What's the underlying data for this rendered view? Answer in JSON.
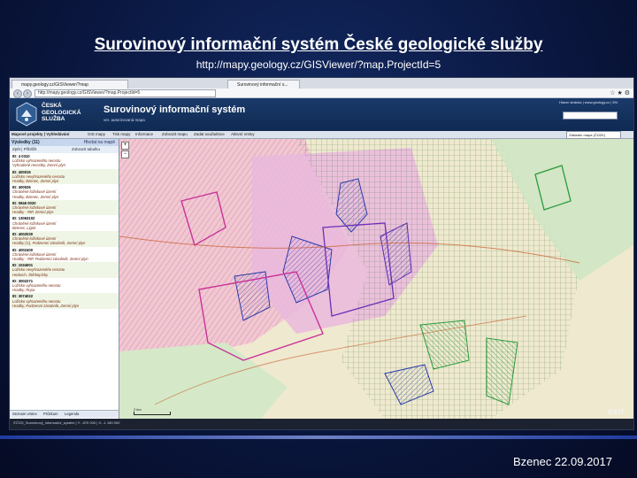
{
  "slide": {
    "title": "Surovinový informační systém České geologické služby",
    "url": "http://mapy.geology.cz/GISViewer/?map.ProjectId=5",
    "footer": "Bzenec 22.09.2017"
  },
  "browser": {
    "tab_1": "mapy.geology.cz/GISViewer/?map",
    "tab_2": "Surovinový informační s...",
    "address": "http://mapy.geology.cz/GISViewer/?map.ProjectId=5",
    "window_controls": "☆ ★ ⚙"
  },
  "app": {
    "logo_line1": "ČESKÁ",
    "logo_line2": "GEOLOGICKÁ",
    "logo_line3": "SLUŽBA",
    "title": "Surovinový informační systém",
    "subtitle": "ver. autorizovaná mapa",
    "header_links": "Hlavní stránka | www.geology.cz | EN",
    "toolbar": [
      "Mapové projekty | Vyhledávání",
      "GIS mapy",
      "Tisk mapy",
      "Informace",
      "Zobrazit mapu",
      "Zadat souřadnice",
      "Aktivní vrstvy"
    ],
    "basemap": "Základní mapa (ČÚZK)",
    "panel": {
      "heading": "Výsledky (11)",
      "heading_right": "Hledat na mapě",
      "tab_left": "Zpět | Přiblížit",
      "tab_right": "Zobrazit tabulku",
      "features": [
        {
          "id": "ID: 4 0310",
          "lines": [
            "Ložisko vyhrazeného nerostu",
            "Vyhradené nerostky, Zemní plyn"
          ]
        },
        {
          "id": "ID: 400015",
          "lines": [
            "Ložisko nevyhrazeného nerostu",
            "Hradky, Bzenec, Zemní plyn"
          ]
        },
        {
          "id": "ID: 400026",
          "lines": [
            "Chráněné ložiskové území",
            "Hradky, Bzenec, Zemní plyn"
          ]
        },
        {
          "id": "ID: 0846 0020",
          "lines": [
            "Chráněné ložiskové území",
            "Hradky - RIP, Zemní plyn"
          ]
        },
        {
          "id": "ID: 13063102",
          "lines": [
            "Chráněné ložiskové území",
            "Bzenec, Lignit"
          ]
        },
        {
          "id": "ID: 4002030",
          "lines": [
            "Chráněné ložiskové území",
            "Hradky (C), Podzemní zásobník, Zemní plyn"
          ]
        },
        {
          "id": "ID: 4002400",
          "lines": [
            "Chráněné ložiskové území",
            "Hradky - RIP, Podzemní zásobník, Zemní plyn"
          ]
        },
        {
          "id": "ID: 1034001",
          "lines": [
            "Ložisko nevyhrazeného nerostu",
            "Hodonín, Štěrkopísky"
          ]
        },
        {
          "id": "ID: 3002271",
          "lines": [
            "Ložisko vyhrazeného nerostu",
            "Hradky, Ropa"
          ]
        },
        {
          "id": "ID: 3074022",
          "lines": [
            "Ložisko vyhrazeného nerostu",
            "Hradky, Podzemní zásobník, Zemní plyn"
          ]
        }
      ],
      "footer_tabs": [
        "Seznam vrstev",
        "Průzkum",
        "Legenda"
      ]
    },
    "scale_label": "2 km",
    "esri": "esri",
    "status": "©ČGS_Surovinový_informační_systém  |  Y: -570 000  |  X: -1 180 000"
  },
  "colors": {
    "slide_bg": "#0a1740",
    "header_blue": "#1a3a6a",
    "deposit_pink": "#e96bb6",
    "deposit_green": "#33bb55",
    "deposit_blue": "#2b3ca8",
    "deposit_violet": "#8a4bd6"
  }
}
